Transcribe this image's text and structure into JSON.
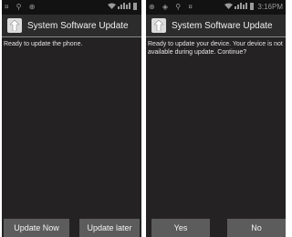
{
  "left_screen": {
    "status": {
      "left_icons": "¤ ⚲ ⊕",
      "signal_icon": "signal-icon"
    },
    "title": "System Software Update",
    "message": "Ready to update the phone.",
    "buttons": {
      "primary": "Update Now",
      "secondary": "Update later"
    }
  },
  "right_screen": {
    "status": {
      "left_icons": "⊕ ◈ ⚲ ¤",
      "time": "3:16PM"
    },
    "title": "System Software Update",
    "message": "Ready to update your device. Your device is not available during update. Continue?",
    "buttons": {
      "primary": "Yes",
      "secondary": "No"
    }
  }
}
